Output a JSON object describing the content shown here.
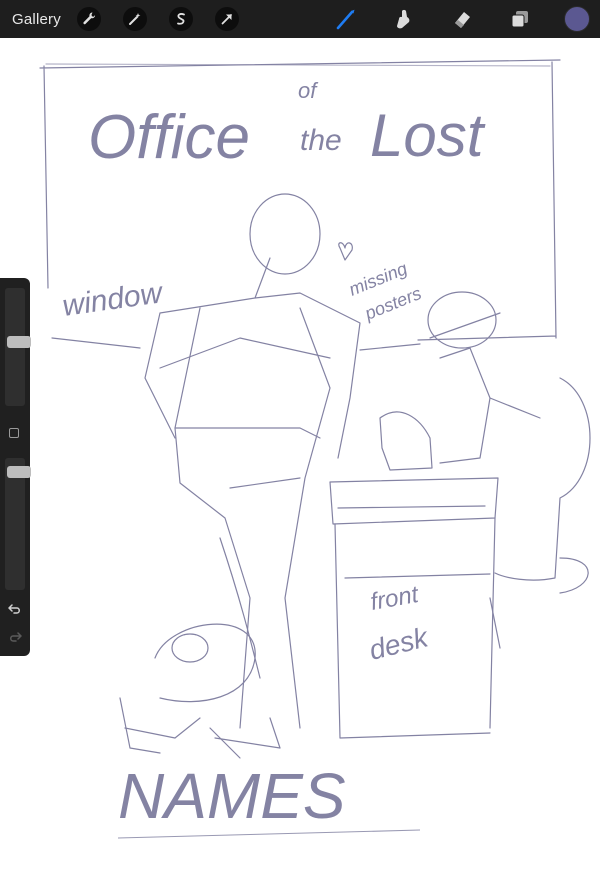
{
  "topbar": {
    "gallery_label": "Gallery",
    "left_tools": [
      "wrench-icon",
      "magic-wand-icon",
      "selection-icon",
      "transform-arrow-icon"
    ],
    "right_tools": [
      "brush-icon",
      "smudge-icon",
      "eraser-icon",
      "layers-icon"
    ],
    "active_tool_color": "#1e7cf2",
    "current_color": "#5b5891"
  },
  "sketch": {
    "title_line1": "Office",
    "title_of": "of",
    "title_the": "the",
    "title_lost": "Lost",
    "window_label": "window",
    "missing_label": "missing",
    "posters_label": "posters",
    "desk_label_1": "front",
    "desk_label_2": "desk",
    "bottom_label": "NAMES",
    "stroke_color": "#6e6d93"
  }
}
